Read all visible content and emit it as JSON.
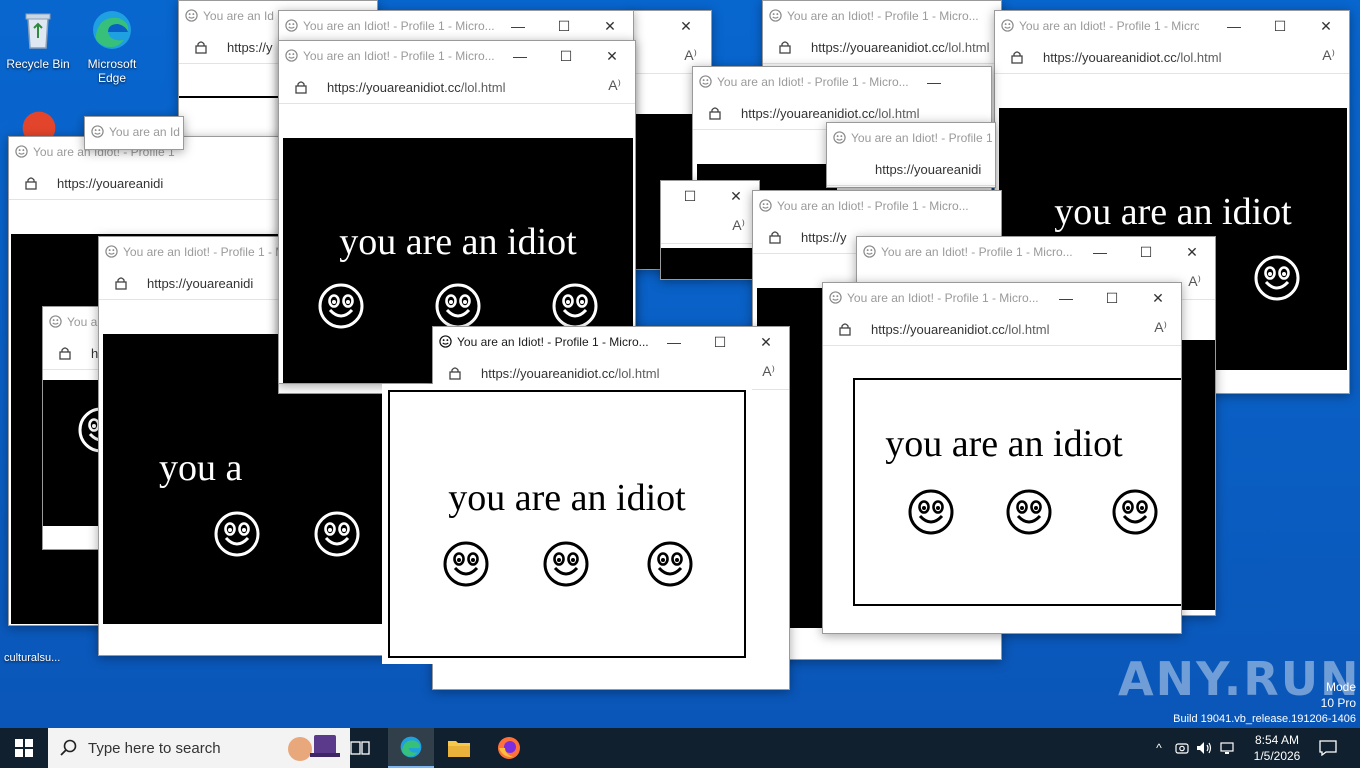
{
  "desktop": {
    "icons": [
      {
        "label": "Recycle Bin",
        "icon": "recycle-bin-icon"
      },
      {
        "label": "Microsoft Edge",
        "icon": "edge-icon"
      }
    ],
    "partial_labels": [
      "culturalsu..."
    ],
    "watermark": {
      "logo_text": "ANY.RUN",
      "mode_text": "Mode",
      "edition_text": "10 Pro",
      "build_text": "Build 19041.vb_release.191206-1406"
    }
  },
  "windows": {
    "title": "You are an Idiot! - Profile 1 - Micro...",
    "title_short": "You are an Idiot! - Profile 1",
    "title_cut_1": "You are an Id",
    "title_cut_2": "You a",
    "url_domain": "https://youareanidiot.cc",
    "url_path": "/lol.html",
    "url_cut": "https://youareanidi",
    "url_cut_2": "https://y",
    "url_cut_3": "h",
    "message": "you are an idiot",
    "message_cut_1": "you a",
    "message_cut_2": "yo",
    "message_cut_3": "you",
    "message_cut_4": "u",
    "controls": {
      "minimize": "—",
      "maximize": "☐",
      "close": "✕"
    },
    "read_aloud": "A⁾"
  },
  "taskbar": {
    "search_placeholder": "Type here to search",
    "pinned": [
      "task-view-icon",
      "edge-icon",
      "file-explorer-icon",
      "firefox-icon"
    ],
    "clock_time": "8:54 AM",
    "clock_date": "1/5/2026",
    "accent": "#0078d7"
  }
}
